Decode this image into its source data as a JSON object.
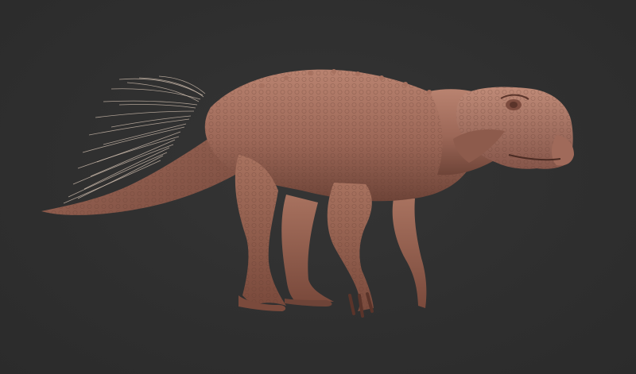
{
  "scene": {
    "background_color": "#2f2f2f",
    "subject": "dinosaur-sculpt",
    "palette": {
      "skin_light": "#b98370",
      "skin_mid": "#9c6757",
      "skin_dark": "#6e4438",
      "bristles": "#d8c6b6"
    }
  }
}
